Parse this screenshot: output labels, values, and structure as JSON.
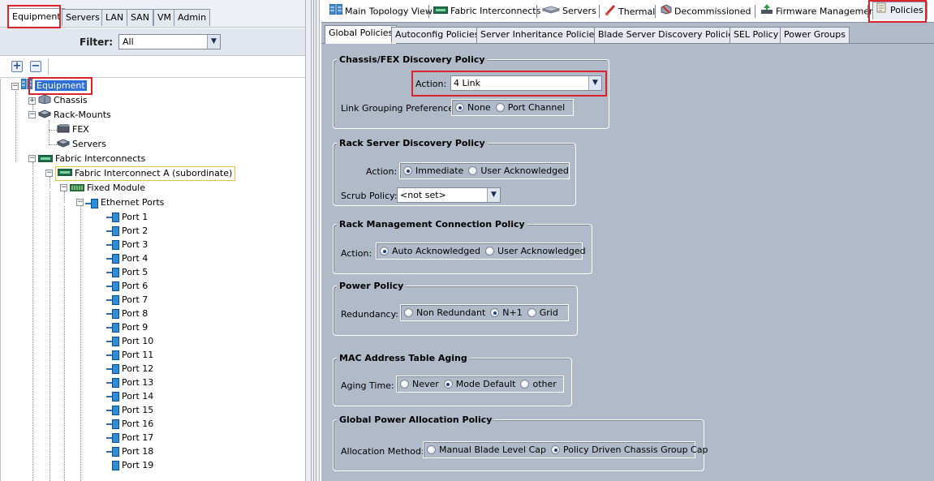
{
  "left": {
    "tabs": [
      {
        "label": "Equipment",
        "active": true
      },
      {
        "label": "Servers"
      },
      {
        "label": "LAN"
      },
      {
        "label": "SAN"
      },
      {
        "label": "VM"
      },
      {
        "label": "Admin"
      }
    ],
    "filter_label": "Filter:",
    "filter_value": "All",
    "expand_all": "+",
    "collapse_all": "−",
    "tree": {
      "root": "Equipment",
      "chassis": "Chassis",
      "rack_mounts": "Rack-Mounts",
      "fex": "FEX",
      "servers": "Servers",
      "fabric_interconnects": "Fabric Interconnects",
      "fi_a": "Fabric Interconnect A (subordinate)",
      "fixed_module": "Fixed Module",
      "ethernet_ports": "Ethernet Ports",
      "ports": [
        "Port 1",
        "Port 2",
        "Port 3",
        "Port 4",
        "Port 5",
        "Port 6",
        "Port 7",
        "Port 8",
        "Port 9",
        "Port 10",
        "Port 11",
        "Port 12",
        "Port 13",
        "Port 14",
        "Port 15",
        "Port 16",
        "Port 17",
        "Port 18",
        "Port 19"
      ]
    }
  },
  "top_tabs": [
    {
      "label": "Main Topology View",
      "icon": "topology-icon"
    },
    {
      "label": "Fabric Interconnects",
      "icon": "fabric-interconnect-icon"
    },
    {
      "label": "Servers",
      "icon": "server-icon"
    },
    {
      "label": "Thermal",
      "icon": "thermal-icon"
    },
    {
      "label": "Decommissioned",
      "icon": "decommissioned-icon"
    },
    {
      "label": "Firmware Management",
      "icon": "firmware-icon"
    },
    {
      "label": "Policies",
      "icon": "policies-icon",
      "active": true
    }
  ],
  "sub_tabs": [
    {
      "label": "Global Policies",
      "active": true
    },
    {
      "label": "Autoconfig Policies"
    },
    {
      "label": "Server Inheritance Policies"
    },
    {
      "label": "Blade Server Discovery Policies"
    },
    {
      "label": "SEL Policy"
    },
    {
      "label": "Power Groups"
    }
  ],
  "sections": {
    "chassis_fex": {
      "title": "Chassis/FEX Discovery Policy",
      "action_label": "Action:",
      "action_value": "4 Link",
      "link_grouping_label": "Link Grouping Preference:",
      "link_grouping_options": [
        "None",
        "Port Channel"
      ],
      "link_grouping_selected": "None"
    },
    "rack_server": {
      "title": "Rack Server Discovery Policy",
      "action_label": "Action:",
      "action_options": [
        "Immediate",
        "User Acknowledged"
      ],
      "action_selected": "Immediate",
      "scrub_label": "Scrub Policy:",
      "scrub_value": "<not set>"
    },
    "rack_mgmt": {
      "title": "Rack Management Connection Policy",
      "action_label": "Action:",
      "action_options": [
        "Auto Acknowledged",
        "User Acknowledged"
      ],
      "action_selected": "Auto Acknowledged"
    },
    "power": {
      "title": "Power Policy",
      "redundancy_label": "Redundancy:",
      "options": [
        "Non Redundant",
        "N+1",
        "Grid"
      ],
      "selected": "N+1"
    },
    "mac_aging": {
      "title": "MAC Address Table Aging",
      "aging_label": "Aging Time:",
      "options": [
        "Never",
        "Mode Default",
        "other"
      ],
      "selected": "Mode Default"
    },
    "global_power": {
      "title": "Global Power Allocation Policy",
      "method_label": "Allocation Method:",
      "options": [
        "Manual Blade Level Cap",
        "Policy Driven Chassis Group Cap"
      ],
      "selected": "Policy Driven Chassis Group Cap"
    }
  },
  "colors": {
    "highlight_box": "#d9232d",
    "panel_bg": "#b0bac8",
    "tree_selected_bg": "#2f6fd6"
  }
}
